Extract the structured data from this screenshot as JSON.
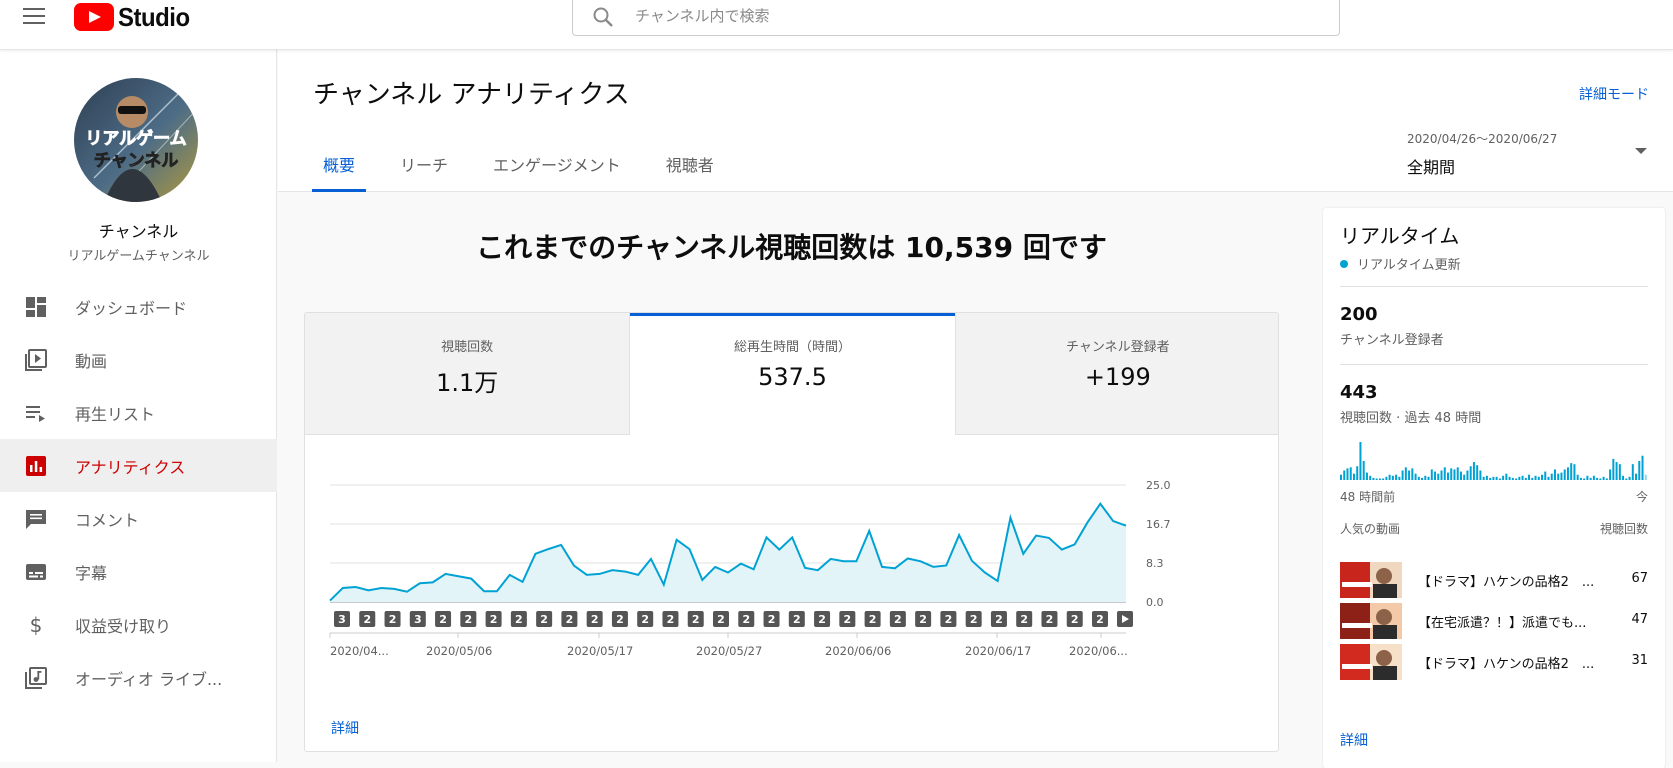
{
  "app": {
    "logo_text": "Studio"
  },
  "search": {
    "placeholder": "チャンネル内で検索"
  },
  "channel": {
    "name": "チャンネル",
    "subtitle": "リアルゲームチャンネル",
    "avatar_text_1": "リアルゲーム",
    "avatar_text_2": "チャンネル"
  },
  "sidebar": {
    "items": [
      {
        "label": "ダッシュボード",
        "icon": "dashboard-icon",
        "active": false
      },
      {
        "label": "動画",
        "icon": "video-library-icon",
        "active": false
      },
      {
        "label": "再生リスト",
        "icon": "playlist-icon",
        "active": false
      },
      {
        "label": "アナリティクス",
        "icon": "analytics-icon",
        "active": true
      },
      {
        "label": "コメント",
        "icon": "comment-icon",
        "active": false
      },
      {
        "label": "字幕",
        "icon": "subtitles-icon",
        "active": false
      },
      {
        "label": "収益受け取り",
        "icon": "dollar-icon",
        "active": false
      },
      {
        "label": "オーディオ ライブ...",
        "icon": "audio-library-icon",
        "active": false
      }
    ]
  },
  "header": {
    "title": "チャンネル アナリティクス",
    "detail_mode": "詳細モード",
    "tabs": [
      {
        "label": "概要",
        "active": true
      },
      {
        "label": "リーチ",
        "active": false
      },
      {
        "label": "エンゲージメント",
        "active": false
      },
      {
        "label": "視聴者",
        "active": false
      }
    ],
    "date_range": {
      "range": "2020/04/26～2020/06/27",
      "label": "全期間"
    }
  },
  "summary": {
    "headline": "これまでのチャンネル視聴回数は 10,539 回です",
    "metrics": [
      {
        "label": "視聴回数",
        "value": "1.1万",
        "active": false
      },
      {
        "label": "総再生時間（時間）",
        "value": "537.5",
        "active": true
      },
      {
        "label": "チャンネル登録者",
        "value": "+199",
        "active": false
      }
    ],
    "detail_link": "詳細"
  },
  "chart_data": {
    "type": "area",
    "title": "",
    "xlabel": "",
    "ylabel": "",
    "ylim": [
      0,
      25.0
    ],
    "y_ticks": [
      "25.0",
      "16.7",
      "8.3",
      "0.0"
    ],
    "x_tick_labels": [
      "2020/04...",
      "2020/05/06",
      "2020/05/17",
      "2020/05/27",
      "2020/06/06",
      "2020/06/17",
      "2020/06..."
    ],
    "series": [
      {
        "values": [
          0.3,
          3.0,
          3.2,
          2.5,
          3.0,
          2.8,
          2.2,
          4.0,
          4.2,
          6.0,
          5.5,
          5.0,
          2.3,
          2.3,
          5.8,
          4.3,
          10.3,
          11.3,
          12.2,
          7.8,
          5.8,
          6.0,
          6.8,
          6.5,
          5.8,
          9.2,
          3.7,
          13.3,
          11.3,
          4.7,
          7.5,
          6.3,
          8.2,
          7.0,
          13.8,
          11.2,
          13.8,
          7.3,
          6.8,
          9.2,
          8.7,
          8.7,
          15.2,
          7.5,
          7.2,
          9.3,
          8.7,
          7.5,
          7.8,
          14.3,
          8.8,
          6.3,
          4.5,
          18.0,
          10.3,
          14.2,
          13.7,
          11.2,
          12.3,
          17.0,
          21.0,
          17.3,
          16.3
        ]
      }
    ],
    "marker_badges": [
      "3",
      "2",
      "2",
      "3",
      "2",
      "2",
      "2",
      "2",
      "2",
      "2",
      "2",
      "2",
      "2",
      "2",
      "2",
      "2",
      "2",
      "2",
      "2",
      "2",
      "2",
      "2",
      "2",
      "2",
      "2",
      "2",
      "2",
      "2",
      "2",
      "2",
      "2"
    ],
    "colors": {
      "line": "#00a2d4",
      "fill": "#e3f4f9"
    }
  },
  "realtime": {
    "title": "リアルタイム",
    "live_label": "リアルタイム更新",
    "subscribers": {
      "value": "200",
      "label": "チャンネル登録者"
    },
    "views": {
      "value": "443",
      "label": "視聴回数 · 過去 48 時間"
    },
    "axis_left": "48 時間前",
    "axis_right": "今",
    "hourly_views": [
      5,
      9,
      11,
      12,
      6,
      13,
      36,
      18,
      7,
      4,
      2,
      1,
      1,
      0,
      3,
      5,
      4,
      5,
      3,
      9,
      12,
      9,
      11,
      6,
      3,
      2,
      4,
      3,
      10,
      8,
      6,
      9,
      12,
      7,
      11,
      10,
      12,
      8,
      5,
      9,
      13,
      17,
      14,
      9,
      3,
      4,
      2,
      3,
      3,
      1,
      4,
      6,
      3,
      2,
      1,
      3,
      4,
      2,
      5,
      2,
      4,
      3,
      5,
      8,
      3,
      6,
      10,
      6,
      7,
      10,
      12,
      16,
      15,
      5,
      2,
      1,
      4,
      2,
      4,
      2,
      1,
      3,
      0,
      10,
      20,
      17,
      15,
      4,
      1,
      3,
      15,
      6,
      18,
      23,
      5
    ],
    "list_header": {
      "left": "人気の動画",
      "right": "視聴回数"
    },
    "videos": [
      {
        "title": "【ドラマ】ハケンの品格2　...",
        "views": "67"
      },
      {
        "title": "【在宅派遣？！】派遣でも...",
        "views": "47"
      },
      {
        "title": "【ドラマ】ハケンの品格2　...",
        "views": "31"
      }
    ],
    "detail_link": "詳細",
    "bar_color": "#00a2d4"
  }
}
